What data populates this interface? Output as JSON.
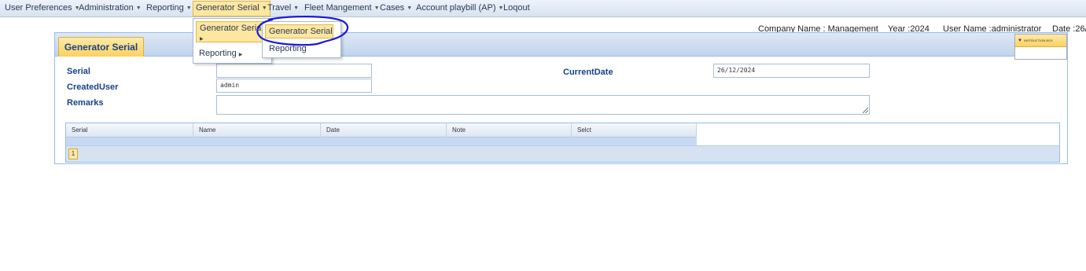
{
  "menubar": {
    "items": [
      {
        "label": "User Preferences",
        "caret": true
      },
      {
        "label": "Administration",
        "caret": true
      },
      {
        "label": "Reporting",
        "caret": true
      },
      {
        "label": "Generator Serial",
        "caret": true,
        "active": true
      },
      {
        "label": "Travel",
        "caret": true
      },
      {
        "label": "Fleet Mangement",
        "caret": true
      },
      {
        "label": "Cases",
        "caret": true
      },
      {
        "label": "Account playbill (AP)",
        "caret": true
      },
      {
        "label": "Loqout",
        "caret": false
      }
    ]
  },
  "menu": {
    "caret_glyph": "▼",
    "submenu_glyph": "▶",
    "level1": [
      {
        "label": "Generator Serial"
      },
      {
        "label": "Reporting"
      }
    ],
    "level2": [
      {
        "label": "Generator Serial"
      },
      {
        "label": "Reporting"
      }
    ]
  },
  "info": {
    "company": "Company Name : Management",
    "year": "Year :2024",
    "user": "User Name :administrator",
    "date": "Date :26/"
  },
  "panel": {
    "tab_title": "Generator Serial",
    "labels": {
      "serial": "Serial",
      "created_user": "CreatedUser",
      "remarks": "Remarks",
      "current_date": "CurrentDate"
    },
    "values": {
      "serial": "",
      "created_user": "admin",
      "current_date": "26/12/2024",
      "remarks": ""
    }
  },
  "grid": {
    "columns": [
      "Serial",
      "Name",
      "Date",
      "Note",
      "Selct"
    ],
    "pager": {
      "current_page": "1"
    }
  },
  "instruction_box": {
    "title": "INSTRUCTION BOX"
  },
  "colors": {
    "accent_yellow": "#fde7a0",
    "header_blue": "#15428b",
    "annotation": "#1a1ad6"
  }
}
